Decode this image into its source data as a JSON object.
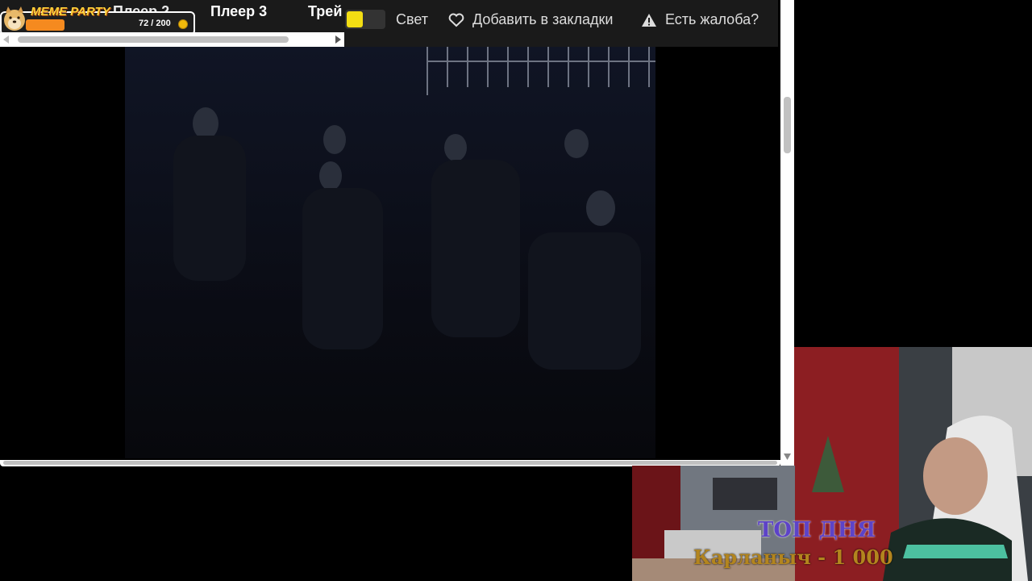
{
  "meme_party": {
    "logo": "MEME PARTY",
    "progress_text": "72 / 200",
    "progress_fraction": 0.36,
    "coin_icon": "coin-icon"
  },
  "header": {
    "tabs": [
      "Плеер 2",
      "Плеер 3",
      "Трей"
    ],
    "light_toggle_label": "Свет",
    "light_toggle_color": "#f3de13",
    "bookmark_label": "Добавить в закладки",
    "complaint_label": "Есть жалоба?"
  },
  "stream_overlay": {
    "top_day": "ТОП ДНЯ",
    "top_entry": "Карланыч - 1 000"
  }
}
